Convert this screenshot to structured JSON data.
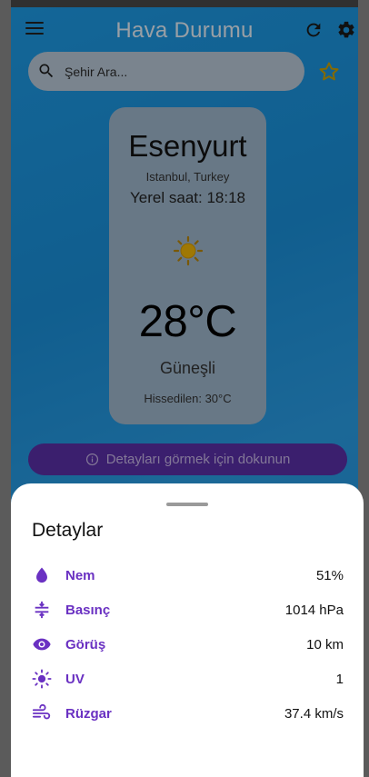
{
  "app": {
    "title": "Hava Durumu"
  },
  "search": {
    "placeholder": "Şehir Ara..."
  },
  "weather": {
    "city": "Esenyurt",
    "region": "Istanbul, Turkey",
    "local_time": "Yerel saat: 18:18",
    "temperature": "28°C",
    "condition": "Güneşli",
    "feels_like": "Hissedilen: 30°C",
    "icon": "sun-icon"
  },
  "details_button": {
    "label": "Detayları görmek için dokunun"
  },
  "sheet": {
    "title": "Detaylar",
    "rows": [
      {
        "label": "Nem",
        "value": "51%",
        "icon": "water-drop-icon"
      },
      {
        "label": "Basınç",
        "value": "1014 hPa",
        "icon": "compress-icon"
      },
      {
        "label": "Görüş",
        "value": "10 km",
        "icon": "eye-icon"
      },
      {
        "label": "UV",
        "value": "1",
        "icon": "uv-sun-icon"
      },
      {
        "label": "Rüzgar",
        "value": "37.4 km/s",
        "icon": "wind-icon"
      }
    ]
  },
  "colors": {
    "accent_purple": "#6a31c2",
    "sky_blue": "#1e9be6",
    "sun_yellow": "#f2b705"
  }
}
